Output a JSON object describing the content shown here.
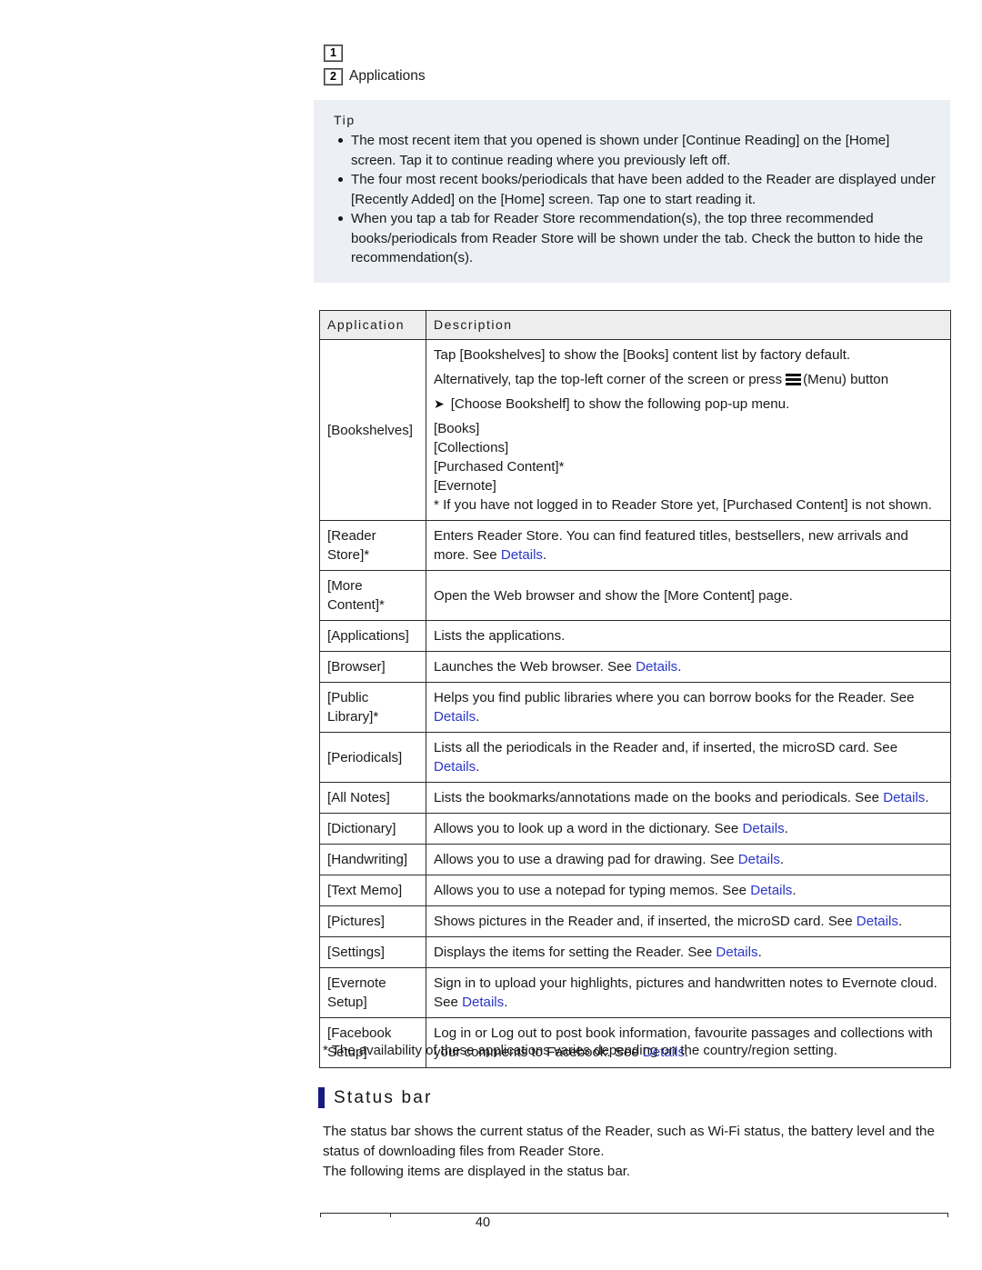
{
  "breadcrumb": {
    "step1": "1",
    "step2": "2",
    "step2_label": "Applications"
  },
  "tip": {
    "title": "Tip",
    "items": [
      "The most recent item that you opened is shown under [Continue Reading] on the [Home] screen. Tap it to continue reading where you previously left off.",
      "The four most recent books/periodicals that have been added to the Reader are displayed under [Recently Added] on the [Home] screen. Tap one to start reading it.",
      "When you tap a tab for Reader Store recommendation(s), the top three recommended books/periodicals from Reader Store will be shown under the tab. Check the button to hide the recommendation(s)."
    ]
  },
  "table": {
    "headers": {
      "application": "Application",
      "description": "Description"
    },
    "bookshelves": {
      "app": "[Bookshelves]",
      "line1": "Tap [Bookshelves] to show the [Books] content list by factory default.",
      "line2_a": "Alternatively, tap the top-left corner of the screen or press",
      "line2_b": "(Menu) button",
      "line3": "[Choose Bookshelf] to show the following pop-up menu.",
      "menu_items": [
        "[Books]",
        "[Collections]",
        "[Purchased Content]*",
        "[Evernote]"
      ],
      "note": "* If you have not logged in to Reader Store yet, [Purchased Content] is not shown."
    },
    "rows": [
      {
        "app": "[Reader Store]*",
        "desc_pre": "Enters Reader Store. You can find featured titles, bestsellers, new arrivals and more. See ",
        "link": "Details",
        "desc_post": "."
      },
      {
        "app": "[More Content]*",
        "desc_pre": "Open the Web browser and show the [More Content] page.",
        "link": "",
        "desc_post": ""
      },
      {
        "app": "[Applications]",
        "desc_pre": "Lists the applications.",
        "link": "",
        "desc_post": ""
      },
      {
        "app": "[Browser]",
        "desc_pre": "Launches the Web browser. See ",
        "link": "Details",
        "desc_post": "."
      },
      {
        "app": "[Public Library]*",
        "desc_pre": "Helps you find public libraries where you can borrow books for the Reader. See ",
        "link": "Details",
        "desc_post": "."
      },
      {
        "app": "[Periodicals]",
        "desc_pre": "Lists all the periodicals in the Reader and, if inserted, the microSD card. See ",
        "link": "Details",
        "desc_post": "."
      },
      {
        "app": "[All Notes]",
        "desc_pre": "Lists the bookmarks/annotations made on the books and periodicals. See ",
        "link": "Details",
        "desc_post": "."
      },
      {
        "app": "[Dictionary]",
        "desc_pre": "Allows you to look up a word in the dictionary. See ",
        "link": "Details",
        "desc_post": "."
      },
      {
        "app": "[Handwriting]",
        "desc_pre": "Allows you to use a drawing pad for drawing. See ",
        "link": "Details",
        "desc_post": "."
      },
      {
        "app": "[Text Memo]",
        "desc_pre": "Allows you to use a notepad for typing memos. See ",
        "link": "Details",
        "desc_post": "."
      },
      {
        "app": "[Pictures]",
        "desc_pre": "Shows pictures in the Reader and, if inserted, the microSD card. See ",
        "link": "Details",
        "desc_post": "."
      },
      {
        "app": "[Settings]",
        "desc_pre": "Displays the items for setting the Reader. See ",
        "link": "Details",
        "desc_post": "."
      },
      {
        "app": "[Evernote Setup]",
        "desc_pre": "Sign in to upload your highlights, pictures and handwritten notes to Evernote cloud. See ",
        "link": "Details",
        "desc_post": "."
      },
      {
        "app": "[Facebook Setup]",
        "desc_pre": "Log in or Log out to post book information, favourite passages and collections with your comments to Facebook. See ",
        "link": "Details",
        "desc_post": "."
      }
    ]
  },
  "footnote": "* The availability of these applications varies depending on the country/region setting.",
  "status_bar_section": {
    "title": "Status bar",
    "paragraph1": "The status bar shows the current status of the Reader, such as Wi-Fi status, the battery level and the status of downloading files from Reader Store.",
    "paragraph2": "The following items are displayed in the status bar."
  },
  "footer": {
    "page_number": "40"
  },
  "colors": {
    "link": "#2b37c8",
    "tip_background": "#eceff3",
    "table_header_background": "#ededed",
    "section_marker": "#191982",
    "border": "#2b2b2b"
  }
}
